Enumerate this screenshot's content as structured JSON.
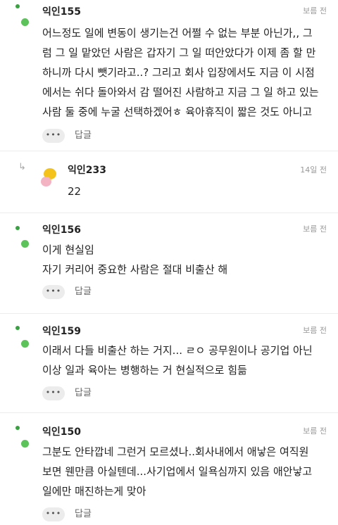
{
  "comments": [
    {
      "author": "익인155",
      "time": "보름 전",
      "lines": [
        "어느정도 일에 변동이 생기는건 어쩔 수 없는 부분 아닌가,, 그",
        "럼 그 일 맡았던 사람은 갑자기 그 일 떠안았다가 이제 좀 할 만",
        "하니까 다시 뺏기라고..? 그리고 회사 입장에서도 지금 이 시점",
        "에서는 쉬다 돌아와서 감 떨어진 사람하고 지금 그 일 하고 있는",
        "사람 둘 중에 누굴 선택하겠어ㅎ 육아휴직이 짧은 것도 아니고"
      ],
      "more_label": "•••",
      "reply_label": "답글"
    },
    {
      "author": "익인233",
      "time": "14일 전",
      "lines": [
        "22"
      ],
      "is_reply": true,
      "reply_arrow": "↳"
    },
    {
      "author": "익인156",
      "time": "보름 전",
      "lines": [
        "이게 현실임",
        "자기 커리어 중요한 사람은 절대 비출산 해"
      ],
      "more_label": "•••",
      "reply_label": "답글"
    },
    {
      "author": "익인159",
      "time": "보름 전",
      "lines": [
        "이래서 다들 비출산 하는 거지... ㄹㅇ 공무원이나 공기업 아닌",
        "이상 일과 육아는 병행하는 거 현실적으로 힘듦"
      ],
      "more_label": "•••",
      "reply_label": "답글"
    },
    {
      "author": "익인150",
      "time": "보름 전",
      "lines": [
        "그분도 안타깝네 그런거 모르셨나..회사내에서 애낳은 여직원",
        "보면 웬만큼 아실텐데...사기업에서 일욕심까지 있음 애안낳고",
        "일에만 매진하는게 맞아"
      ],
      "more_label": "•••",
      "reply_label": "답글"
    }
  ],
  "colors": {
    "avatar_green_dot": "#5cc25a",
    "avatar_green_small": "#3aa142",
    "reply_avatar_yellow": "#f3c21b",
    "reply_avatar_pink": "#f3b3c3",
    "separator": "#ececec"
  }
}
